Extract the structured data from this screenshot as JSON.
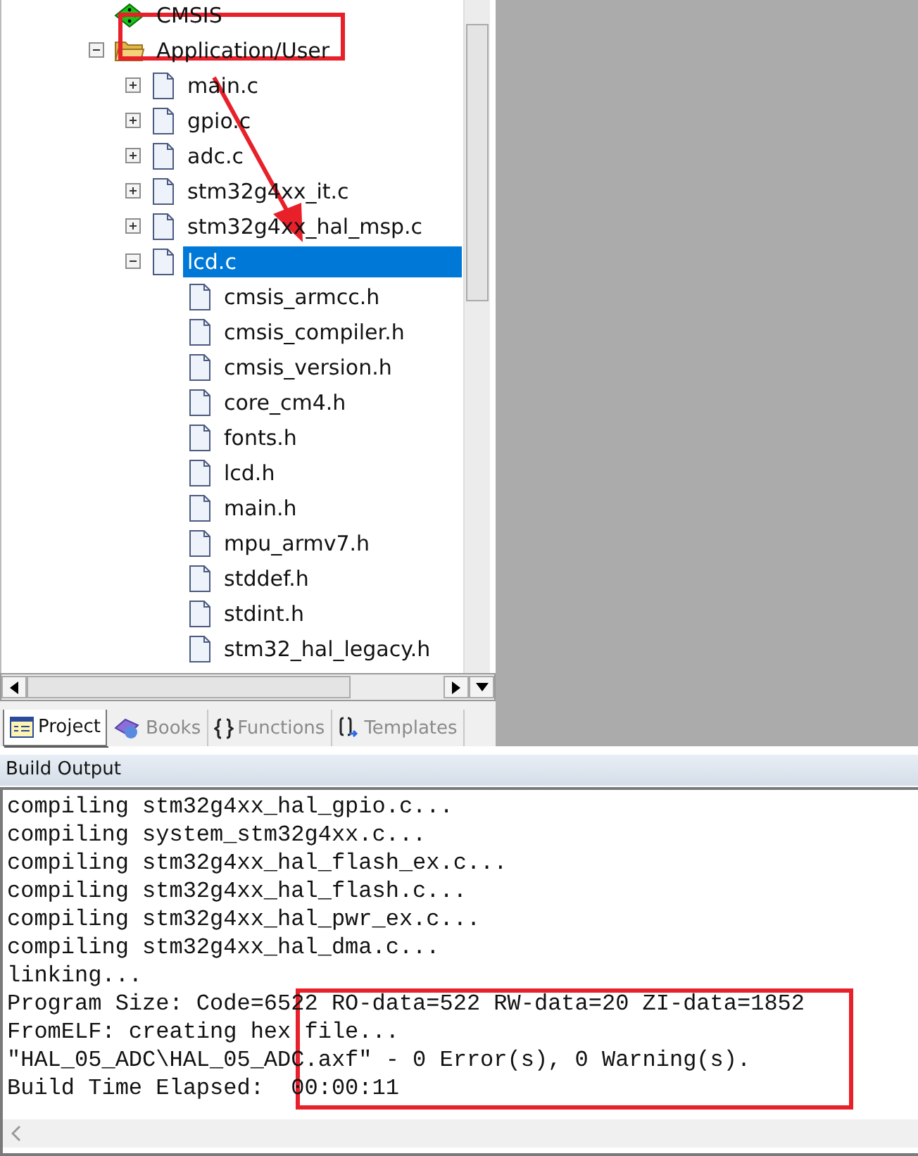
{
  "project_tree": [
    {
      "label": "CMSIS",
      "kind": "component"
    },
    {
      "label": "Application/User",
      "kind": "folder",
      "expanded": true,
      "children": [
        {
          "label": "main.c",
          "kind": "file",
          "expanded": false,
          "selected": false
        },
        {
          "label": "gpio.c",
          "kind": "file",
          "expanded": false,
          "selected": false
        },
        {
          "label": "adc.c",
          "kind": "file",
          "expanded": false,
          "selected": false
        },
        {
          "label": "stm32g4xx_it.c",
          "kind": "file",
          "expanded": false,
          "selected": false
        },
        {
          "label": "stm32g4xx_hal_msp.c",
          "kind": "file",
          "expanded": false,
          "selected": false
        },
        {
          "label": "lcd.c",
          "kind": "file",
          "expanded": true,
          "selected": true,
          "children": [
            {
              "label": "cmsis_armcc.h",
              "kind": "header"
            },
            {
              "label": "cmsis_compiler.h",
              "kind": "header"
            },
            {
              "label": "cmsis_version.h",
              "kind": "header"
            },
            {
              "label": "core_cm4.h",
              "kind": "header"
            },
            {
              "label": "fonts.h",
              "kind": "header"
            },
            {
              "label": "lcd.h",
              "kind": "header"
            },
            {
              "label": "main.h",
              "kind": "header"
            },
            {
              "label": "mpu_armv7.h",
              "kind": "header"
            },
            {
              "label": "stddef.h",
              "kind": "header"
            },
            {
              "label": "stdint.h",
              "kind": "header"
            },
            {
              "label": "stm32_hal_legacy.h",
              "kind": "header"
            }
          ]
        }
      ]
    }
  ],
  "panel_tabs": [
    {
      "label": "Project",
      "kind": "project",
      "selected": true
    },
    {
      "label": "Books",
      "kind": "books",
      "selected": false
    },
    {
      "label": "Functions",
      "kind": "functions",
      "selected": false
    },
    {
      "label": "Templates",
      "kind": "templates",
      "selected": false
    }
  ],
  "build_output": {
    "title": "Build Output",
    "lines": [
      "compiling stm32g4xx_hal_gpio.c...",
      "compiling system_stm32g4xx.c...",
      "compiling stm32g4xx_hal_flash_ex.c...",
      "compiling stm32g4xx_hal_flash.c...",
      "compiling stm32g4xx_hal_pwr_ex.c...",
      "compiling stm32g4xx_hal_dma.c...",
      "linking...",
      "Program Size: Code=6522 RO-data=522 RW-data=20 ZI-data=1852",
      "FromELF: creating hex file...",
      "\"HAL_05_ADC\\HAL_05_ADC.axf\" - 0 Error(s), 0 Warning(s).",
      "Build Time Elapsed:  00:00:11"
    ]
  }
}
